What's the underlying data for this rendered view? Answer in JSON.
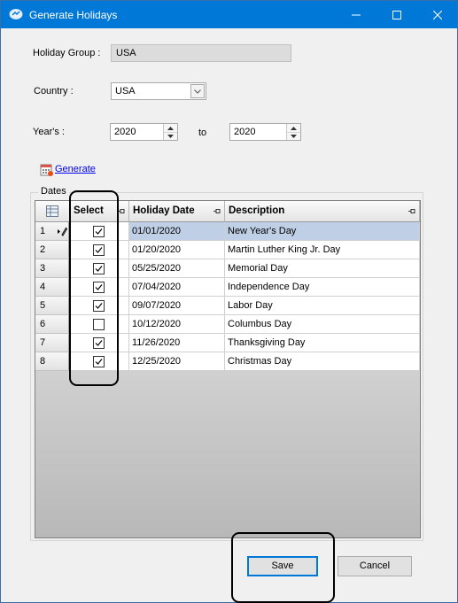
{
  "window": {
    "title": "Generate Holidays",
    "minimize_icon": "minimize-icon",
    "maximize_icon": "maximize-icon",
    "close_icon": "close-icon",
    "titlebar_color": "#0078d7"
  },
  "form": {
    "holiday_group_label": "Holiday Group :",
    "holiday_group_value": "USA",
    "country_label": "Country :",
    "country_value": "USA",
    "years_label": "Year's :",
    "year_from": "2020",
    "to_label": "to",
    "year_to": "2020",
    "generate_link": "Generate"
  },
  "dates_group": {
    "caption": "Dates",
    "columns": {
      "select": "Select",
      "holiday_date": "Holiday Date",
      "description": "Description"
    },
    "rows": [
      {
        "num": "1",
        "checked": true,
        "date": "01/01/2020",
        "description": "New Year's Day"
      },
      {
        "num": "2",
        "checked": true,
        "date": "01/20/2020",
        "description": "Martin Luther King Jr. Day"
      },
      {
        "num": "3",
        "checked": true,
        "date": "05/25/2020",
        "description": "Memorial Day"
      },
      {
        "num": "4",
        "checked": true,
        "date": "07/04/2020",
        "description": "Independence Day"
      },
      {
        "num": "5",
        "checked": true,
        "date": "09/07/2020",
        "description": "Labor Day"
      },
      {
        "num": "6",
        "checked": false,
        "date": "10/12/2020",
        "description": "Columbus Day"
      },
      {
        "num": "7",
        "checked": true,
        "date": "11/26/2020",
        "description": "Thanksgiving Day"
      },
      {
        "num": "8",
        "checked": true,
        "date": "12/25/2020",
        "description": "Christmas Day"
      }
    ]
  },
  "buttons": {
    "save": "Save",
    "cancel": "Cancel"
  }
}
